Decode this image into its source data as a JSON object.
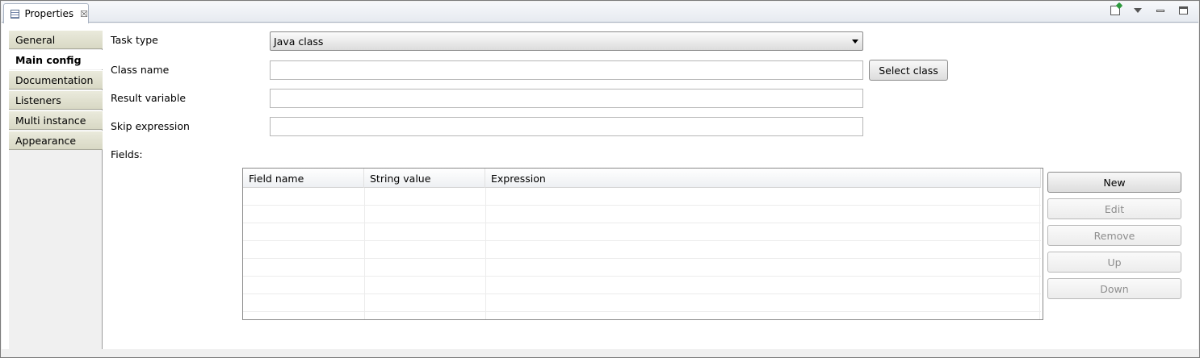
{
  "view": {
    "tab_label": "Properties"
  },
  "sidebar": {
    "items": [
      {
        "label": "General",
        "selected": false
      },
      {
        "label": "Main config",
        "selected": true
      },
      {
        "label": "Documentation",
        "selected": false
      },
      {
        "label": "Listeners",
        "selected": false
      },
      {
        "label": "Multi instance",
        "selected": false
      },
      {
        "label": "Appearance",
        "selected": false
      }
    ]
  },
  "form": {
    "task_type": {
      "label": "Task type",
      "value": "Java class"
    },
    "class_name": {
      "label": "Class name",
      "value": ""
    },
    "select_class_label": "Select class",
    "result_variable": {
      "label": "Result variable",
      "value": ""
    },
    "skip_expression": {
      "label": "Skip expression",
      "value": ""
    },
    "fields_label": "Fields:"
  },
  "fields_table": {
    "columns": [
      "Field name",
      "String value",
      "Expression"
    ],
    "rows": []
  },
  "buttons": {
    "new": "New",
    "edit": "Edit",
    "remove": "Remove",
    "up": "Up",
    "down": "Down"
  }
}
